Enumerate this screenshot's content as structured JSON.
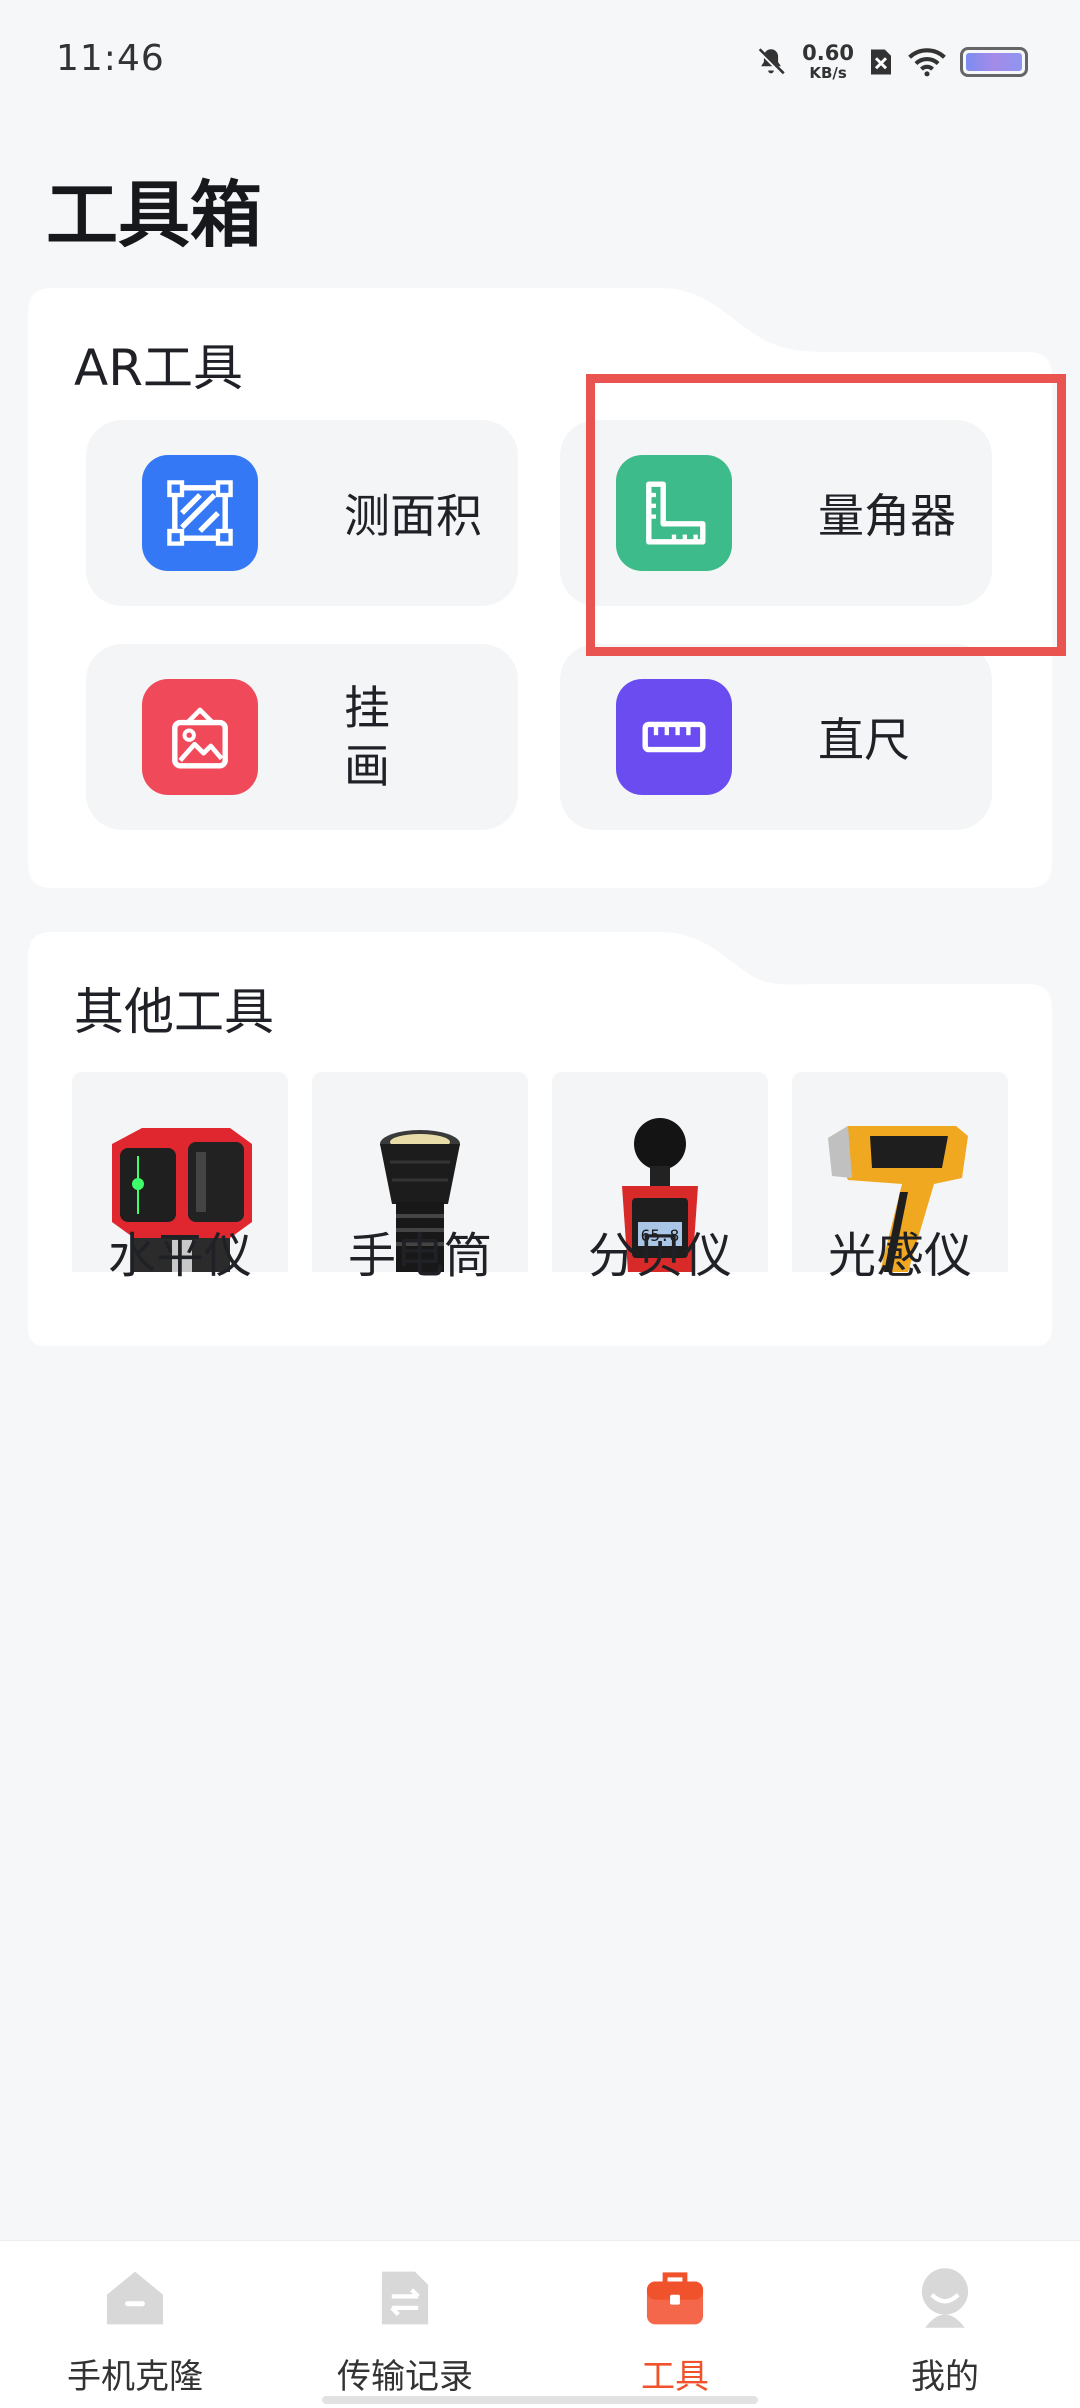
{
  "status_bar": {
    "time": "11:46",
    "net_speed": "0.60",
    "net_unit": "KB/s",
    "icons": [
      "bell-mute-icon",
      "sim-blocked-icon",
      "wifi-icon",
      "battery-icon"
    ]
  },
  "page": {
    "title": "工具箱"
  },
  "ar_tools": {
    "title": "AR工具",
    "items": [
      {
        "label": "测面积",
        "icon": "area-measure-icon",
        "color": "#3478f6"
      },
      {
        "label": "量角器",
        "icon": "protractor-icon",
        "color": "#3dbb8a"
      },
      {
        "label": "挂画",
        "icon": "hang-picture-icon",
        "color": "#f04a5a"
      },
      {
        "label": "直尺",
        "icon": "ruler-icon",
        "color": "#6a4cf0"
      }
    ],
    "highlight_color": "#e95450"
  },
  "other_tools": {
    "title": "其他工具",
    "items": [
      {
        "label": "水平仪",
        "icon": "laser-level-icon"
      },
      {
        "label": "手电筒",
        "icon": "flashlight-icon"
      },
      {
        "label": "分贝仪",
        "icon": "decibel-meter-icon",
        "reading": "65.8"
      },
      {
        "label": "光感仪",
        "icon": "light-meter-icon"
      }
    ]
  },
  "bottom_nav": {
    "items": [
      {
        "label": "手机克隆",
        "icon": "home-clone-icon"
      },
      {
        "label": "传输记录",
        "icon": "transfer-record-icon"
      },
      {
        "label": "工具",
        "icon": "toolbox-icon",
        "active": true
      },
      {
        "label": "我的",
        "icon": "profile-icon"
      }
    ],
    "active_color": "#f0532b"
  }
}
